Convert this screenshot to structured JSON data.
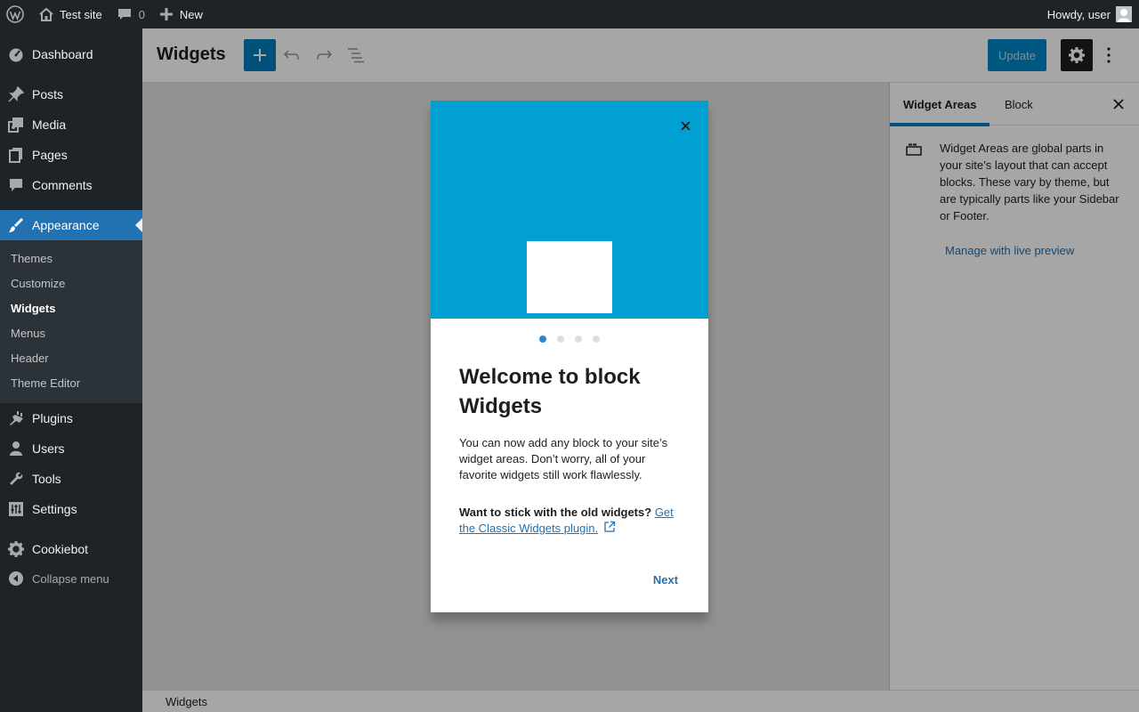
{
  "adminbar": {
    "site_name": "Test site",
    "comments_count": "0",
    "new_label": "New",
    "howdy": "Howdy, user"
  },
  "sidebar": {
    "items": [
      {
        "label": "Dashboard",
        "icon": "dashboard-icon"
      },
      {
        "label": "Posts",
        "icon": "pin-icon"
      },
      {
        "label": "Media",
        "icon": "media-icon"
      },
      {
        "label": "Pages",
        "icon": "pages-icon"
      },
      {
        "label": "Comments",
        "icon": "comment-icon"
      },
      {
        "label": "Appearance",
        "icon": "paintbrush-icon"
      },
      {
        "label": "Plugins",
        "icon": "plugin-icon"
      },
      {
        "label": "Users",
        "icon": "user-icon"
      },
      {
        "label": "Tools",
        "icon": "wrench-icon"
      },
      {
        "label": "Settings",
        "icon": "settings-icon"
      },
      {
        "label": "Cookiebot",
        "icon": "gear-icon"
      }
    ],
    "appearance_submenu": [
      "Themes",
      "Customize",
      "Widgets",
      "Menus",
      "Header",
      "Theme Editor"
    ],
    "collapse_label": "Collapse menu"
  },
  "header": {
    "title": "Widgets",
    "update_label": "Update"
  },
  "inspector": {
    "tabs": [
      "Widget Areas",
      "Block"
    ],
    "description": "Widget Areas are global parts in your site’s layout that can accept blocks. These vary by theme, but are typically parts like your Sidebar or Footer.",
    "link": "Manage with live preview"
  },
  "footer": {
    "breadcrumb": "Widgets"
  },
  "modal": {
    "title": "Welcome to block Widgets",
    "text": "You can now add any block to your site’s widget areas. Don’t worry, all of your favorite widgets still work flawlessly.",
    "note_bold": "Want to stick with the old widgets?",
    "note_link": "Get the Classic Widgets plugin.",
    "next_label": "Next",
    "page_count": 4,
    "current_page": 1
  },
  "colors": {
    "accent": "#007cba",
    "hero": "#00a0d2",
    "adminbar": "#1d2327"
  }
}
